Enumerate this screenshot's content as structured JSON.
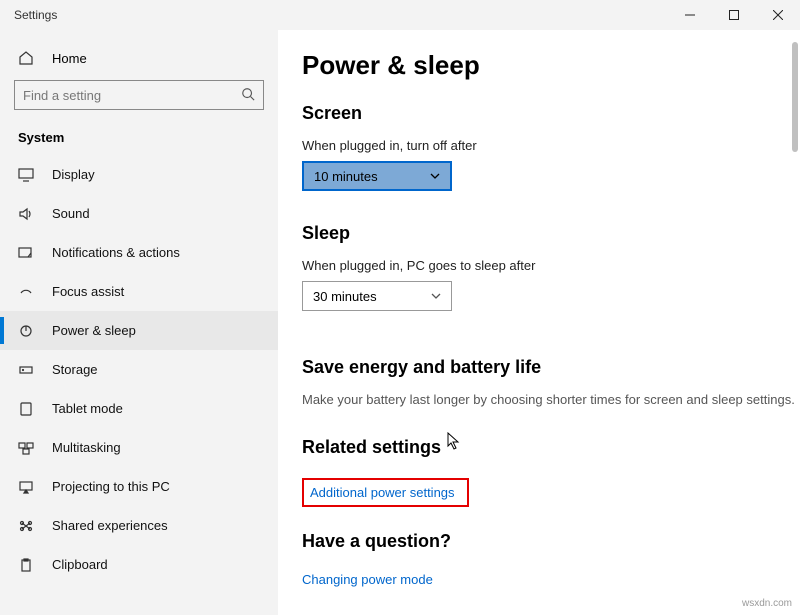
{
  "window": {
    "title": "Settings"
  },
  "sidebar": {
    "home": "Home",
    "search_placeholder": "Find a setting",
    "section": "System",
    "items": [
      {
        "label": "Display"
      },
      {
        "label": "Sound"
      },
      {
        "label": "Notifications & actions"
      },
      {
        "label": "Focus assist"
      },
      {
        "label": "Power & sleep"
      },
      {
        "label": "Storage"
      },
      {
        "label": "Tablet mode"
      },
      {
        "label": "Multitasking"
      },
      {
        "label": "Projecting to this PC"
      },
      {
        "label": "Shared experiences"
      },
      {
        "label": "Clipboard"
      }
    ]
  },
  "main": {
    "title": "Power & sleep",
    "screen": {
      "heading": "Screen",
      "label": "When plugged in, turn off after",
      "value": "10 minutes"
    },
    "sleep": {
      "heading": "Sleep",
      "label": "When plugged in, PC goes to sleep after",
      "value": "30 minutes"
    },
    "energy": {
      "heading": "Save energy and battery life",
      "desc": "Make your battery last longer by choosing shorter times for screen and sleep settings."
    },
    "related": {
      "heading": "Related settings",
      "link": "Additional power settings"
    },
    "question": {
      "heading": "Have a question?",
      "link": "Changing power mode"
    }
  },
  "watermark": "wsxdn.com"
}
